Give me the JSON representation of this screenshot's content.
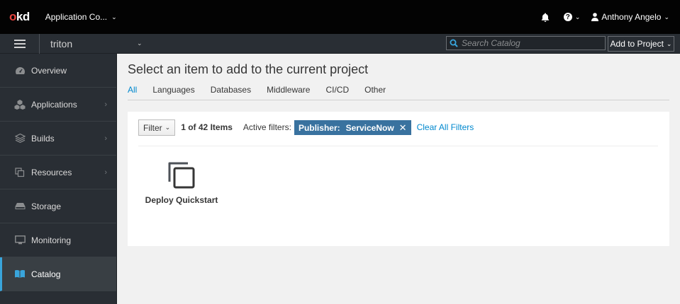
{
  "masthead": {
    "logo_o": "o",
    "logo_kd": "kd",
    "app_switcher": "Application Co...",
    "user_name": "Anthony Angelo",
    "icons": [
      "bell-icon",
      "help-icon",
      "user-icon"
    ]
  },
  "projbar": {
    "project_name": "triton",
    "search_placeholder": "Search Catalog",
    "add_to_project": "Add to Project"
  },
  "sidebar": {
    "items": [
      {
        "label": "Overview",
        "icon": "dashboard-icon",
        "has_arrow": false
      },
      {
        "label": "Applications",
        "icon": "cubes-icon",
        "has_arrow": true
      },
      {
        "label": "Builds",
        "icon": "layers-icon",
        "has_arrow": true
      },
      {
        "label": "Resources",
        "icon": "copy-icon",
        "has_arrow": true
      },
      {
        "label": "Storage",
        "icon": "drive-icon",
        "has_arrow": false
      },
      {
        "label": "Monitoring",
        "icon": "monitor-icon",
        "has_arrow": false
      },
      {
        "label": "Catalog",
        "icon": "book-icon",
        "has_arrow": false,
        "active": true
      }
    ]
  },
  "main": {
    "title": "Select an item to add to the current project",
    "tabs": [
      "All",
      "Languages",
      "Databases",
      "Middleware",
      "CI/CD",
      "Other"
    ],
    "active_tab": "All",
    "filter_label": "Filter",
    "item_count": "1 of 42 Items",
    "active_filters_label": "Active filters:",
    "chip_key": "Publisher:",
    "chip_value": "ServiceNow",
    "clear_all": "Clear All Filters",
    "tiles": [
      {
        "title": "Deploy Quickstart",
        "icon": "copy-icon"
      }
    ]
  },
  "colors": {
    "accent": "#0088ce",
    "chip": "#39729f",
    "active_nav": "#39a5dc",
    "logo_o": "#e8433e"
  }
}
